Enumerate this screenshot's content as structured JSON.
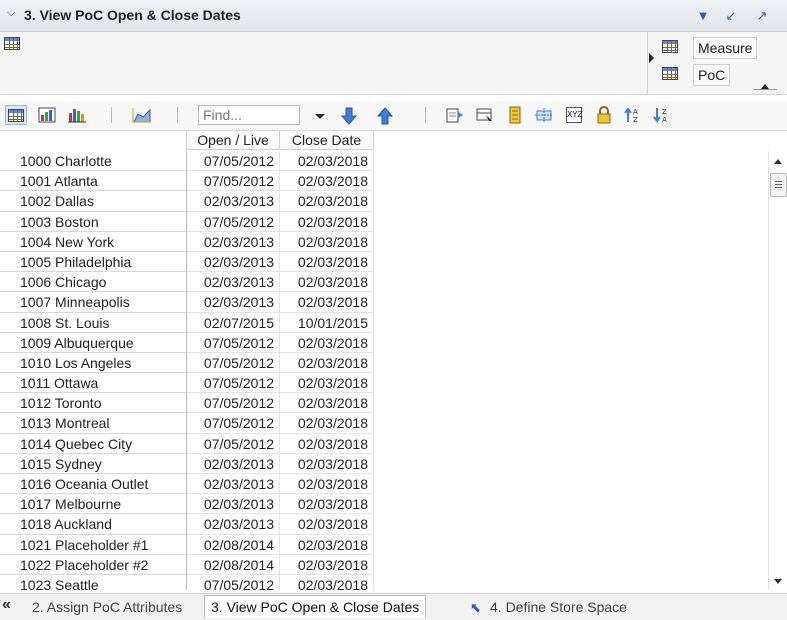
{
  "title_bar": {
    "title": "3. View PoC Open & Close Dates",
    "collapse_icon": "chevron-down-icon",
    "menu_icon": "dropdown-triangle-icon",
    "minimize_icon": "arrow-minimize-icon",
    "restore_icon": "arrow-restore-icon"
  },
  "pov": {
    "items": [
      {
        "label": "Measure",
        "icon": "grid-icon"
      },
      {
        "label": "PoC",
        "icon": "grid-icon"
      }
    ]
  },
  "toolbar": {
    "find_placeholder": "Find...",
    "find_value": "Find..."
  },
  "table": {
    "columns": [
      "Open / Live",
      "Close Date"
    ],
    "rows": [
      {
        "label": "1000 Charlotte",
        "open": "07/05/2012",
        "close": "02/03/2018"
      },
      {
        "label": "1001 Atlanta",
        "open": "07/05/2012",
        "close": "02/03/2018"
      },
      {
        "label": "1002 Dallas",
        "open": "02/03/2013",
        "close": "02/03/2018"
      },
      {
        "label": "1003 Boston",
        "open": "07/05/2012",
        "close": "02/03/2018"
      },
      {
        "label": "1004 New York",
        "open": "02/03/2013",
        "close": "02/03/2018"
      },
      {
        "label": "1005 Philadelphia",
        "open": "02/03/2013",
        "close": "02/03/2018"
      },
      {
        "label": "1006 Chicago",
        "open": "02/03/2013",
        "close": "02/03/2018"
      },
      {
        "label": "1007 Minneapolis",
        "open": "02/03/2013",
        "close": "02/03/2018"
      },
      {
        "label": "1008 St. Louis",
        "open": "02/07/2015",
        "close": "10/01/2015"
      },
      {
        "label": "1009 Albuquerque",
        "open": "07/05/2012",
        "close": "02/03/2018"
      },
      {
        "label": "1010 Los Angeles",
        "open": "07/05/2012",
        "close": "02/03/2018"
      },
      {
        "label": "1011 Ottawa",
        "open": "07/05/2012",
        "close": "02/03/2018"
      },
      {
        "label": "1012 Toronto",
        "open": "07/05/2012",
        "close": "02/03/2018"
      },
      {
        "label": "1013 Montreal",
        "open": "07/05/2012",
        "close": "02/03/2018"
      },
      {
        "label": "1014 Quebec City",
        "open": "07/05/2012",
        "close": "02/03/2018"
      },
      {
        "label": "1015 Sydney",
        "open": "02/03/2013",
        "close": "02/03/2018"
      },
      {
        "label": "1016 Oceania Outlet",
        "open": "02/03/2013",
        "close": "02/03/2018"
      },
      {
        "label": "1017 Melbourne",
        "open": "02/03/2013",
        "close": "02/03/2018"
      },
      {
        "label": "1018 Auckland",
        "open": "02/03/2013",
        "close": "02/03/2018"
      },
      {
        "label": "1021 Placeholder #1",
        "open": "02/08/2014",
        "close": "02/03/2018"
      },
      {
        "label": "1022 Placeholder #2",
        "open": "02/08/2014",
        "close": "02/03/2018"
      },
      {
        "label": "1023 Seattle",
        "open": "07/05/2012",
        "close": "02/03/2018"
      }
    ]
  },
  "tabs": {
    "prev": "2. Assign PoC Attributes",
    "active": "3. View PoC Open & Close Dates",
    "next": "4. Define Store Space"
  },
  "colors": {
    "accent": "#2a5db0",
    "title_bg": "#e1e5ea",
    "grid_border": "#e3e3e3"
  }
}
